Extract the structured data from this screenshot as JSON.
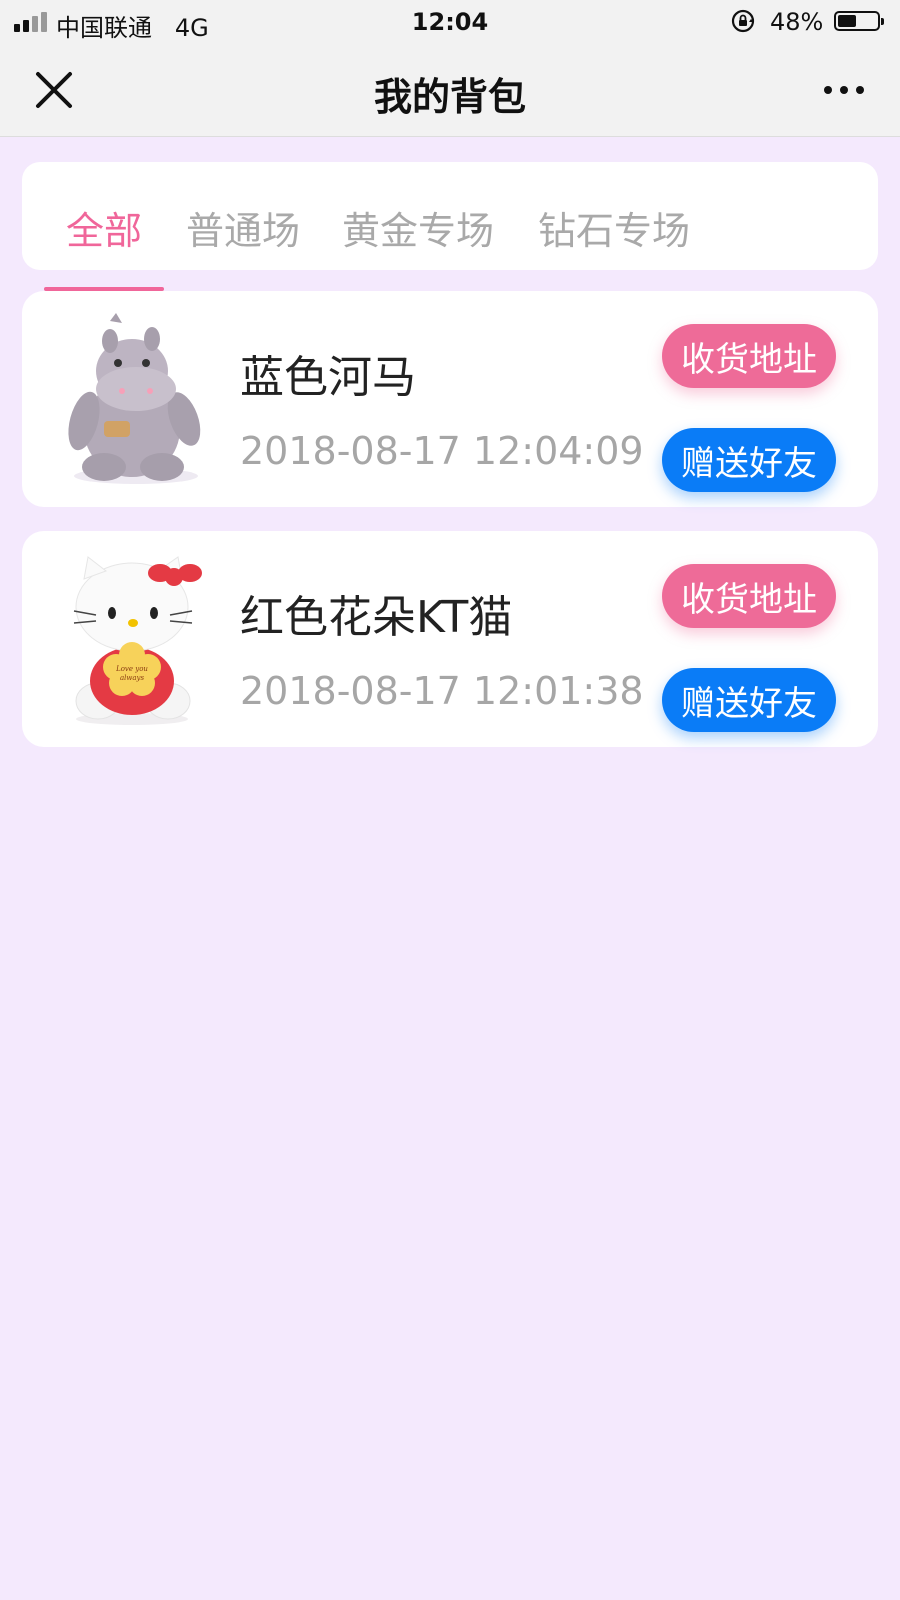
{
  "status_bar": {
    "carrier": "中国联通",
    "network": "4G",
    "time": "12:04",
    "battery_text": "48%",
    "battery_level": 0.48
  },
  "nav": {
    "title": "我的背包",
    "close_icon": "close-icon",
    "more_icon": "more-icon"
  },
  "tabs": [
    {
      "label": "全部",
      "active": true
    },
    {
      "label": "普通场",
      "active": false
    },
    {
      "label": "黄金专场",
      "active": false
    },
    {
      "label": "钻石专场",
      "active": false
    }
  ],
  "items": [
    {
      "name": "蓝色河马",
      "time": "2018-08-17 12:04:09",
      "thumb_icon": "hippo-plush-image",
      "address_label": "收货地址",
      "gift_label": "赠送好友"
    },
    {
      "name": "红色花朵KT猫",
      "time": "2018-08-17 12:01:38",
      "thumb_icon": "hello-kitty-plush-image",
      "thumb_text": "Love you always",
      "address_label": "收货地址",
      "gift_label": "赠送好友"
    }
  ],
  "colors": {
    "accent_pink": "#ee6b98",
    "accent_blue": "#0a7cf7",
    "page_background": "#f4e9fd"
  }
}
